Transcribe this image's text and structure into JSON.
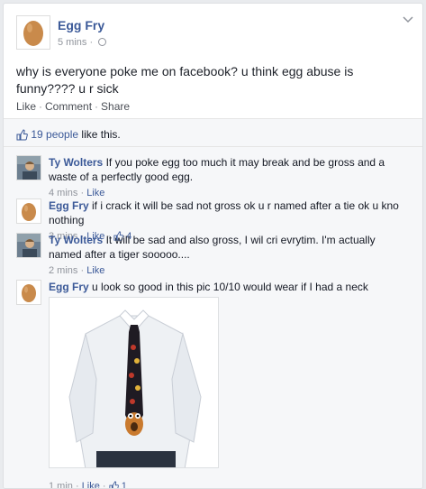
{
  "post": {
    "author": "Egg Fry",
    "time": "5 mins",
    "separator": "·",
    "text": "why is everyone poke me on facebook? u think egg abuse is funny???? u r sick",
    "actions": {
      "like": "Like",
      "comment": "Comment",
      "share": "Share"
    }
  },
  "likes": {
    "count": "19 people",
    "suffix": "like this."
  },
  "comments": [
    {
      "author": "Ty Wolters",
      "avatar": "man-avatar",
      "text": "If you poke egg too much it may break and be gross and a waste of a perfectly good egg.",
      "time": "4 mins",
      "like": "Like",
      "likes_count": ""
    },
    {
      "author": "Egg Fry",
      "avatar": "egg-avatar",
      "text": "if i crack it will be sad not gross ok u r named after a tie ok u kno nothing",
      "time": "3 mins",
      "like": "Like",
      "likes_count": "4"
    },
    {
      "author": "Ty Wolters",
      "avatar": "man-avatar",
      "text": "It will be sad and also gross, I wil cri evrytim. I'm actually named after a tiger sooooo....",
      "time": "2 mins",
      "like": "Like",
      "likes_count": ""
    },
    {
      "author": "Egg Fry",
      "avatar": "egg-avatar",
      "text": "u look so good in this pic 10/10 would wear if I had a neck",
      "time": "1 min",
      "like": "Like",
      "likes_count": "1",
      "attachment": "man-in-shirt-with-tie-photo"
    }
  ],
  "colors": {
    "link": "#3b5998",
    "muted": "#90949c",
    "background": "#f6f7f9"
  }
}
